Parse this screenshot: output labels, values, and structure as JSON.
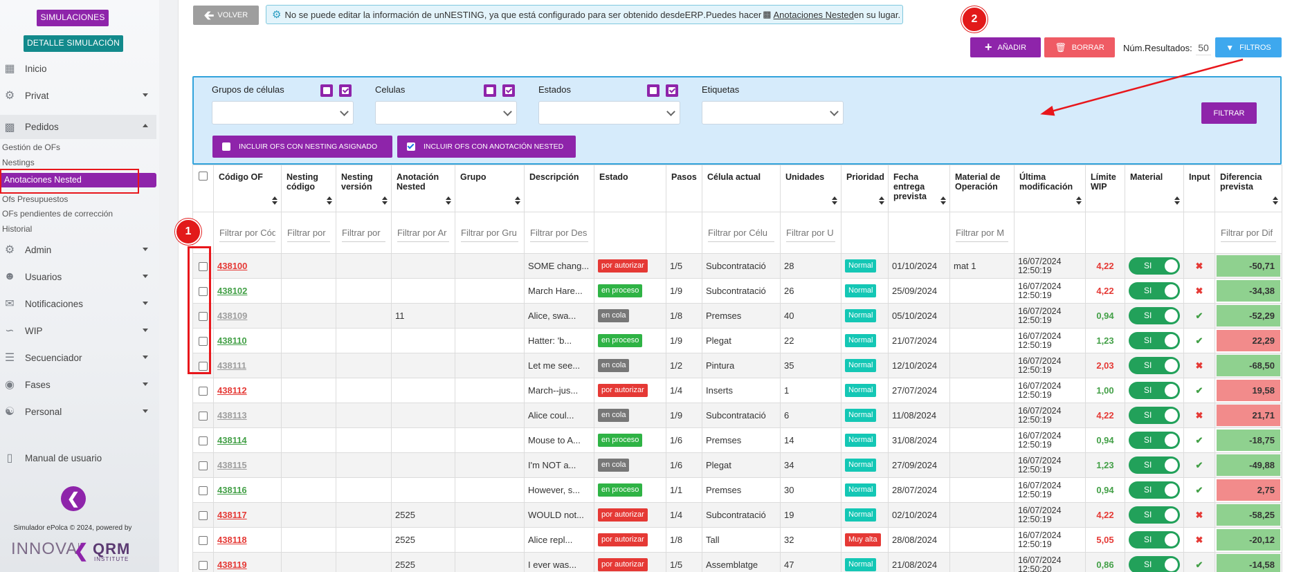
{
  "sidebar": {
    "btn_simulaciones": "SIMULACIONES",
    "btn_detalle": "DETALLE SIMULACIÓN",
    "nav": [
      {
        "label": "Inicio",
        "icon": "dashboard-icon"
      },
      {
        "label": "Privat",
        "icon": "gears-icon"
      },
      {
        "label": "Pedidos",
        "icon": "orders-icon"
      },
      {
        "label": "Admin",
        "icon": "gears-icon"
      },
      {
        "label": "Usuarios",
        "icon": "users-icon"
      },
      {
        "label": "Notificaciones",
        "icon": "envelope-icon"
      },
      {
        "label": "WIP",
        "icon": "chart-line-icon"
      },
      {
        "label": "Secuenciador",
        "icon": "sitemap-icon"
      },
      {
        "label": "Fases",
        "icon": "palette-icon"
      },
      {
        "label": "Personal",
        "icon": "people-icon"
      }
    ],
    "sub_items": [
      "Gestión de OFs",
      "Nestings",
      "Anotaciones Nested",
      "Ofs Presupuestos",
      "OFs pendientes de corrección",
      "Historial"
    ],
    "manual": "Manual de usuario",
    "footer": "Simulador ePolca © 2024, powered by",
    "logo_innova": "INNOVA",
    "logo_innova_sup": "IT",
    "logo_qrm": "QRM",
    "logo_qrm_sub": "INSTITUTE"
  },
  "toolbar": {
    "volver": "VOLVER",
    "info_pre": "No se puede editar la información de un ",
    "info_nesting": "NESTING",
    "info_mid": ", ya que está configurado para ser obtenido desde ",
    "info_erp": "ERP",
    "info_post": ".Puedes hacer ",
    "info_link": "Anotaciones Nested",
    "info_end": " en su lugar.",
    "add": "AÑADIR",
    "delete": "BORRAR",
    "num_results_label": "Núm.Resultados:",
    "num_results_value": "50",
    "filtros": "FILTROS"
  },
  "annotations": {
    "circle1": "1",
    "circle2": "2"
  },
  "filters": {
    "groups": [
      {
        "label": "Grupos de células"
      },
      {
        "label": "Celulas"
      },
      {
        "label": "Estados"
      },
      {
        "label": "Etiquetas"
      }
    ],
    "filtrar": "FILTRAR",
    "include_nesting": "INCLUIR OFS CON NESTING ASIGNADO",
    "include_nesting_checked": false,
    "include_nested": "INCLUIR OFS CON ANOTACIÓN NESTED",
    "include_nested_checked": true
  },
  "table": {
    "headers": [
      "Código OF",
      "Nesting código",
      "Nesting versión",
      "Anotación Nested",
      "Grupo",
      "Descripción",
      "Estado",
      "Pasos",
      "Célula actual",
      "Unidades",
      "Prioridad",
      "Fecha entrega prevista",
      "Material de Operación",
      "Última modificación",
      "Límite WIP",
      "Material",
      "Input",
      "Diferencia prevista"
    ],
    "filter_placeholders": [
      "Filtrar por Cód",
      "Filtrar por",
      "Filtrar por",
      "Filtrar por Ar",
      "Filtrar por Gru",
      "Filtrar por Des",
      "",
      "",
      "Filtrar por Célu",
      "Filtrar por U",
      "",
      "",
      "Filtrar por M",
      "",
      "",
      "",
      "",
      "Filtrar por Dif"
    ],
    "toggle_label": "SI",
    "rows": [
      {
        "code": "438100",
        "code_color": "red",
        "nested": "",
        "desc": "SOME chang...",
        "estado": "por autorizar",
        "estado_color": "red",
        "pasos": "1/5",
        "celula": "Subcontratació",
        "unidades": "28",
        "prioridad": "Normal",
        "prio_color": "teal",
        "fecha": "01/10/2024",
        "material_op": "mat 1",
        "mod_date": "16/07/2024",
        "mod_time": "12:50:19",
        "wip": "4,22",
        "wip_color": "red",
        "input": "x",
        "diff": "-50,71",
        "diff_color": "g"
      },
      {
        "code": "438102",
        "code_color": "green",
        "nested": "",
        "desc": "March Hare...",
        "estado": "en proceso",
        "estado_color": "green",
        "pasos": "1/9",
        "celula": "Subcontratació",
        "unidades": "26",
        "prioridad": "Normal",
        "prio_color": "teal",
        "fecha": "25/09/2024",
        "material_op": "",
        "mod_date": "16/07/2024",
        "mod_time": "12:50:19",
        "wip": "4,22",
        "wip_color": "red",
        "input": "x",
        "diff": "-34,38",
        "diff_color": "g"
      },
      {
        "code": "438109",
        "code_color": "gray",
        "nested": "11",
        "desc": "Alice, swa...",
        "estado": "en cola",
        "estado_color": "gray",
        "pasos": "1/8",
        "celula": "Premses",
        "unidades": "40",
        "prioridad": "Normal",
        "prio_color": "teal",
        "fecha": "05/10/2024",
        "material_op": "",
        "mod_date": "16/07/2024",
        "mod_time": "12:50:19",
        "wip": "0,94",
        "wip_color": "green",
        "input": "ok",
        "diff": "-52,29",
        "diff_color": "g"
      },
      {
        "code": "438110",
        "code_color": "green",
        "nested": "",
        "desc": "Hatter: 'b...",
        "estado": "en proceso",
        "estado_color": "green",
        "pasos": "1/9",
        "celula": "Plegat",
        "unidades": "22",
        "prioridad": "Normal",
        "prio_color": "teal",
        "fecha": "21/07/2024",
        "material_op": "",
        "mod_date": "16/07/2024",
        "mod_time": "12:50:19",
        "wip": "1,23",
        "wip_color": "green",
        "input": "ok",
        "diff": "22,29",
        "diff_color": "r"
      },
      {
        "code": "438111",
        "code_color": "gray",
        "nested": "",
        "desc": "Let me see...",
        "estado": "en cola",
        "estado_color": "gray",
        "pasos": "1/2",
        "celula": "Pintura",
        "unidades": "35",
        "prioridad": "Normal",
        "prio_color": "teal",
        "fecha": "12/10/2024",
        "material_op": "",
        "mod_date": "16/07/2024",
        "mod_time": "12:50:19",
        "wip": "2,03",
        "wip_color": "red",
        "input": "x",
        "diff": "-68,50",
        "diff_color": "g"
      },
      {
        "code": "438112",
        "code_color": "red",
        "nested": "",
        "desc": "March--jus...",
        "estado": "por autorizar",
        "estado_color": "red",
        "pasos": "1/4",
        "celula": "Inserts",
        "unidades": "1",
        "prioridad": "Normal",
        "prio_color": "teal",
        "fecha": "27/07/2024",
        "material_op": "",
        "mod_date": "16/07/2024",
        "mod_time": "12:50:19",
        "wip": "1,00",
        "wip_color": "green",
        "input": "ok",
        "diff": "19,58",
        "diff_color": "r"
      },
      {
        "code": "438113",
        "code_color": "gray",
        "nested": "",
        "desc": "Alice coul...",
        "estado": "en cola",
        "estado_color": "gray",
        "pasos": "1/9",
        "celula": "Subcontratació",
        "unidades": "6",
        "prioridad": "Normal",
        "prio_color": "teal",
        "fecha": "11/08/2024",
        "material_op": "",
        "mod_date": "16/07/2024",
        "mod_time": "12:50:19",
        "wip": "4,22",
        "wip_color": "red",
        "input": "x",
        "diff": "21,71",
        "diff_color": "r"
      },
      {
        "code": "438114",
        "code_color": "green",
        "nested": "",
        "desc": "Mouse to A...",
        "estado": "en proceso",
        "estado_color": "green",
        "pasos": "1/6",
        "celula": "Premses",
        "unidades": "14",
        "prioridad": "Normal",
        "prio_color": "teal",
        "fecha": "31/08/2024",
        "material_op": "",
        "mod_date": "16/07/2024",
        "mod_time": "12:50:19",
        "wip": "0,94",
        "wip_color": "green",
        "input": "ok",
        "diff": "-18,75",
        "diff_color": "g"
      },
      {
        "code": "438115",
        "code_color": "gray",
        "nested": "",
        "desc": "I'm NOT a...",
        "estado": "en cola",
        "estado_color": "gray",
        "pasos": "1/6",
        "celula": "Plegat",
        "unidades": "34",
        "prioridad": "Normal",
        "prio_color": "teal",
        "fecha": "27/09/2024",
        "material_op": "",
        "mod_date": "16/07/2024",
        "mod_time": "12:50:19",
        "wip": "1,23",
        "wip_color": "green",
        "input": "ok",
        "diff": "-49,88",
        "diff_color": "g"
      },
      {
        "code": "438116",
        "code_color": "green",
        "nested": "",
        "desc": "However, s...",
        "estado": "en proceso",
        "estado_color": "green",
        "pasos": "1/1",
        "celula": "Premses",
        "unidades": "30",
        "prioridad": "Normal",
        "prio_color": "teal",
        "fecha": "28/07/2024",
        "material_op": "",
        "mod_date": "16/07/2024",
        "mod_time": "12:50:19",
        "wip": "0,94",
        "wip_color": "green",
        "input": "ok",
        "diff": "2,75",
        "diff_color": "r"
      },
      {
        "code": "438117",
        "code_color": "red",
        "nested": "2525",
        "desc": "WOULD not...",
        "estado": "por autorizar",
        "estado_color": "red",
        "pasos": "1/4",
        "celula": "Subcontratació",
        "unidades": "19",
        "prioridad": "Normal",
        "prio_color": "teal",
        "fecha": "02/10/2024",
        "material_op": "",
        "mod_date": "16/07/2024",
        "mod_time": "12:50:19",
        "wip": "4,22",
        "wip_color": "red",
        "input": "x",
        "diff": "-58,25",
        "diff_color": "g"
      },
      {
        "code": "438118",
        "code_color": "red",
        "nested": "2525",
        "desc": "Alice repl...",
        "estado": "por autorizar",
        "estado_color": "red",
        "pasos": "1/8",
        "celula": "Tall",
        "unidades": "32",
        "prioridad": "Muy alta",
        "prio_color": "mred",
        "fecha": "28/08/2024",
        "material_op": "",
        "mod_date": "16/07/2024",
        "mod_time": "12:50:19",
        "wip": "5,05",
        "wip_color": "red",
        "input": "x",
        "diff": "-20,12",
        "diff_color": "g"
      },
      {
        "code": "438119",
        "code_color": "red",
        "nested": "2525",
        "desc": "I ever was...",
        "estado": "por autorizar",
        "estado_color": "red",
        "pasos": "1/5",
        "celula": "Assemblatge",
        "unidades": "47",
        "prioridad": "Normal",
        "prio_color": "teal",
        "fecha": "21/08/2024",
        "material_op": "",
        "mod_date": "16/07/2024",
        "mod_time": "12:50:20",
        "wip": "0,86",
        "wip_color": "green",
        "input": "ok",
        "diff": "-14,58",
        "diff_color": "g"
      }
    ]
  }
}
